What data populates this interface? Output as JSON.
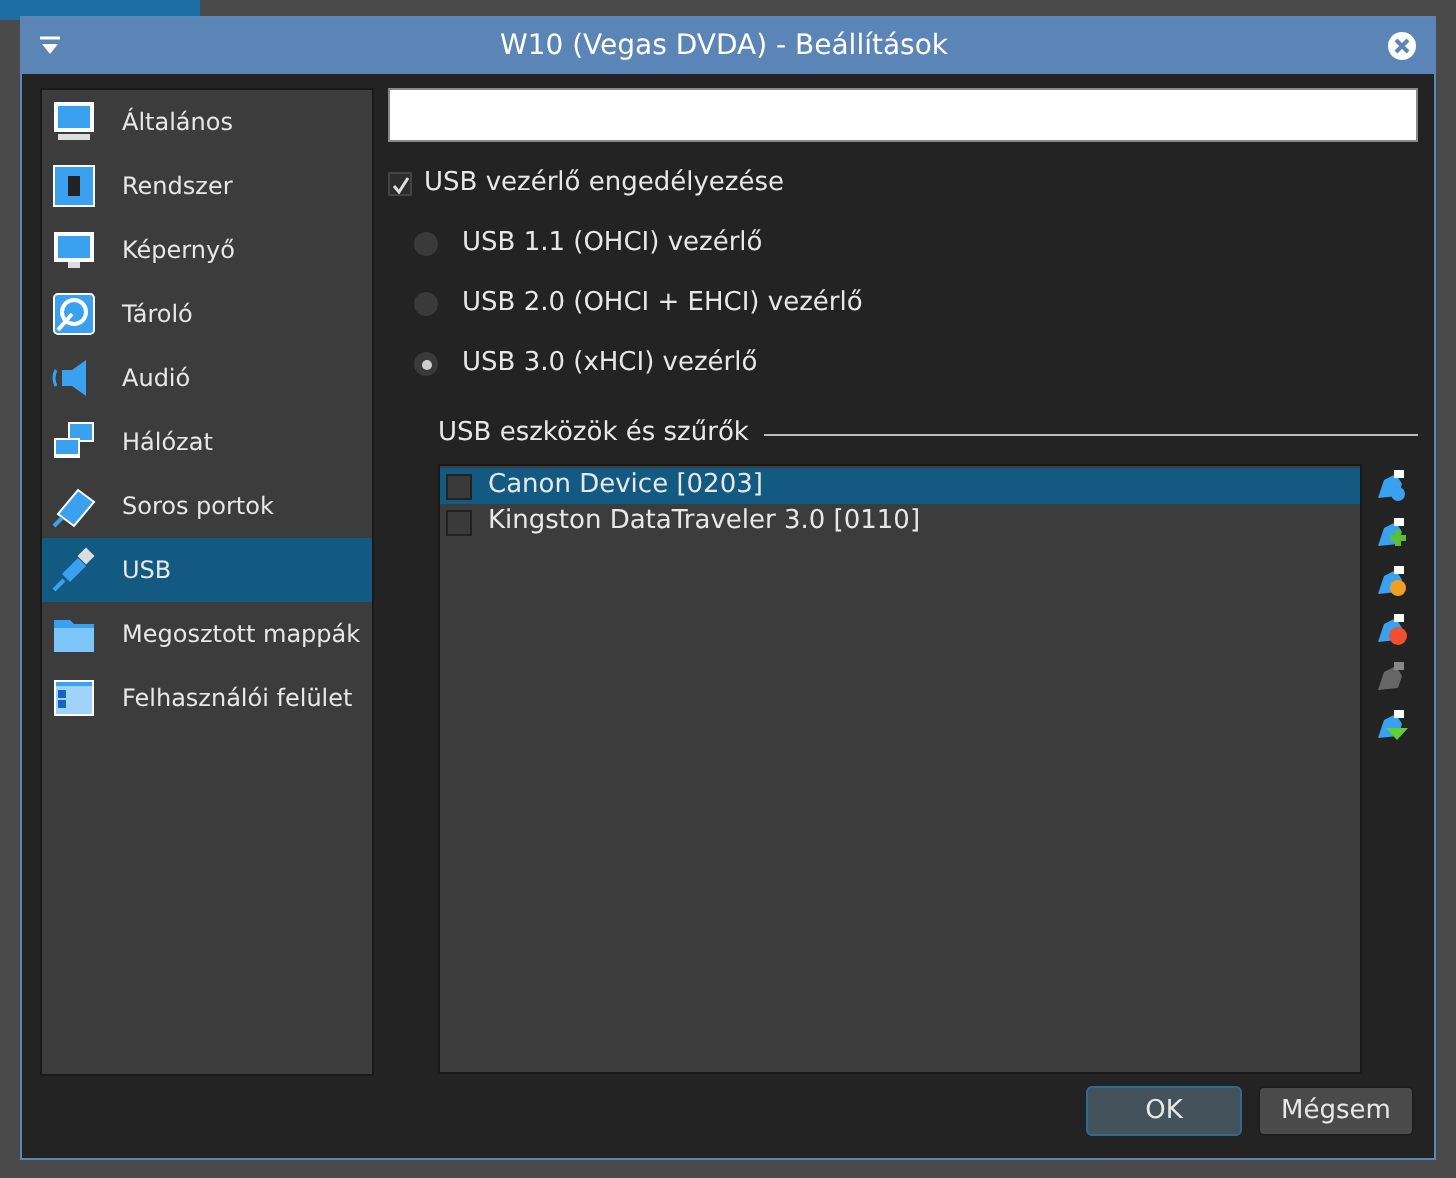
{
  "window": {
    "title": "W10 (Vegas DVDA) - Beállítások"
  },
  "sidebar": {
    "items": [
      {
        "label": "Általános",
        "kind": "general",
        "selected": false
      },
      {
        "label": "Rendszer",
        "kind": "system",
        "selected": false
      },
      {
        "label": "Képernyő",
        "kind": "display",
        "selected": false
      },
      {
        "label": "Tároló",
        "kind": "storage",
        "selected": false
      },
      {
        "label": "Audió",
        "kind": "audio",
        "selected": false
      },
      {
        "label": "Hálózat",
        "kind": "network",
        "selected": false
      },
      {
        "label": "Soros portok",
        "kind": "serial",
        "selected": false
      },
      {
        "label": "USB",
        "kind": "usb",
        "selected": true
      },
      {
        "label": "Megosztott mappák",
        "kind": "folder",
        "selected": false
      },
      {
        "label": "Felhasználói felület",
        "kind": "ui",
        "selected": false
      }
    ]
  },
  "usb": {
    "enable": {
      "label": "USB vezérlő engedélyezése",
      "checked": true
    },
    "controllers": [
      {
        "label": "USB 1.1 (OHCI) vezérlő",
        "selected": false
      },
      {
        "label": "USB 2.0 (OHCI + EHCI) vezérlő",
        "selected": false
      },
      {
        "label": "USB 3.0 (xHCI) vezérlő",
        "selected": true
      }
    ],
    "filters_label": "USB eszközök és szűrők",
    "filters": [
      {
        "label": "Canon Device [0203]",
        "checked": false,
        "selected": true
      },
      {
        "label": "Kingston DataTraveler 3.0 [0110]",
        "checked": false,
        "selected": false
      }
    ],
    "tools": [
      {
        "kind": "add-empty",
        "disabled": false
      },
      {
        "kind": "add",
        "disabled": false
      },
      {
        "kind": "edit",
        "disabled": false
      },
      {
        "kind": "remove",
        "disabled": false
      },
      {
        "kind": "move-up",
        "disabled": true
      },
      {
        "kind": "move-down",
        "disabled": false
      }
    ]
  },
  "buttons": [
    {
      "label": "OK",
      "kind": "default"
    },
    {
      "label": "Mégsem",
      "kind": "normal"
    }
  ]
}
